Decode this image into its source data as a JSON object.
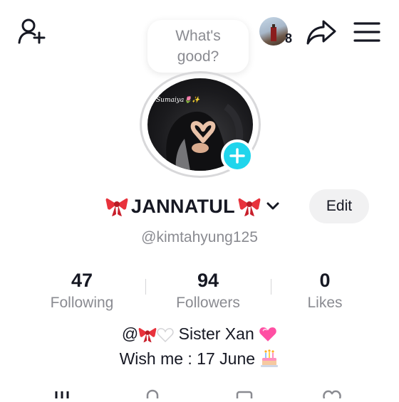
{
  "status_bubble": {
    "text": "What's good?"
  },
  "header": {
    "friends_count": "8"
  },
  "profile": {
    "photo_caption": "Sumaiya🌷✨",
    "display_name": "JANNATUL",
    "edit_label": "Edit",
    "username": "@kimtahyung125"
  },
  "stats": [
    {
      "value": "47",
      "label": "Following"
    },
    {
      "value": "94",
      "label": "Followers"
    },
    {
      "value": "0",
      "label": "Likes"
    }
  ],
  "bio": {
    "line1_prefix": "@",
    "line1_text": "Sister Xan",
    "line2_text": "Wish me : 17 June"
  },
  "colors": {
    "accent": "#20d5ec",
    "secondary_text": "#8a8b91",
    "edit_button_bg": "#f1f1f2",
    "bow_red": "#e8323c"
  },
  "icons": [
    "add-user-icon",
    "share-icon",
    "menu-icon",
    "plus-icon",
    "chevron-down-icon",
    "bow-emoji-icon",
    "white-heart-emoji-icon",
    "pink-heart-emoji-icon",
    "birthday-cake-emoji-icon"
  ]
}
